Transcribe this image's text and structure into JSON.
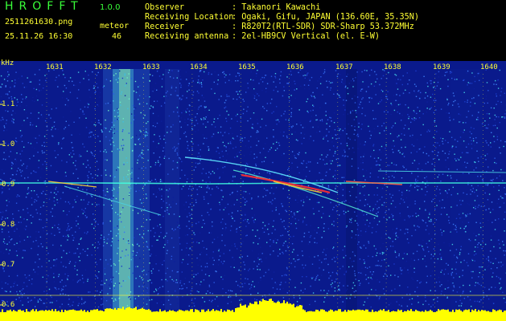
{
  "app": {
    "title": "HROFFT",
    "version": "1.0.0"
  },
  "file": {
    "name": "2511261630.png",
    "datetime": "25.11.26 16:30"
  },
  "meteor": {
    "label": "meteor",
    "count": "46"
  },
  "info": [
    {
      "key": "Observer",
      "value": ": Takanori Kawachi"
    },
    {
      "key": "Receiving Location",
      "value": ": Ogaki, Gifu, JAPAN (136.60E, 35.35N)"
    },
    {
      "key": "Receiver",
      "value": ": R820T2(RTL-SDR) SDR-Sharp 53.372MHz"
    },
    {
      "key": "Receiving antenna",
      "value": ": 2el-HB9CV Vertical (el. E-W)"
    }
  ],
  "axis": {
    "unit": "kHz",
    "y_ticks": [
      "1.1",
      "1.0",
      "0.9",
      "0.8",
      "0.7",
      "0.6"
    ],
    "x_ticks": [
      "1631",
      "1632",
      "1633",
      "1634",
      "1635",
      "1636",
      "1637",
      "1638",
      "1639",
      "1640"
    ]
  },
  "colors": {
    "background": "#0a1a8c",
    "label": "#ffff33",
    "title": "#39ff39",
    "carrier": "#40ffe0"
  }
}
